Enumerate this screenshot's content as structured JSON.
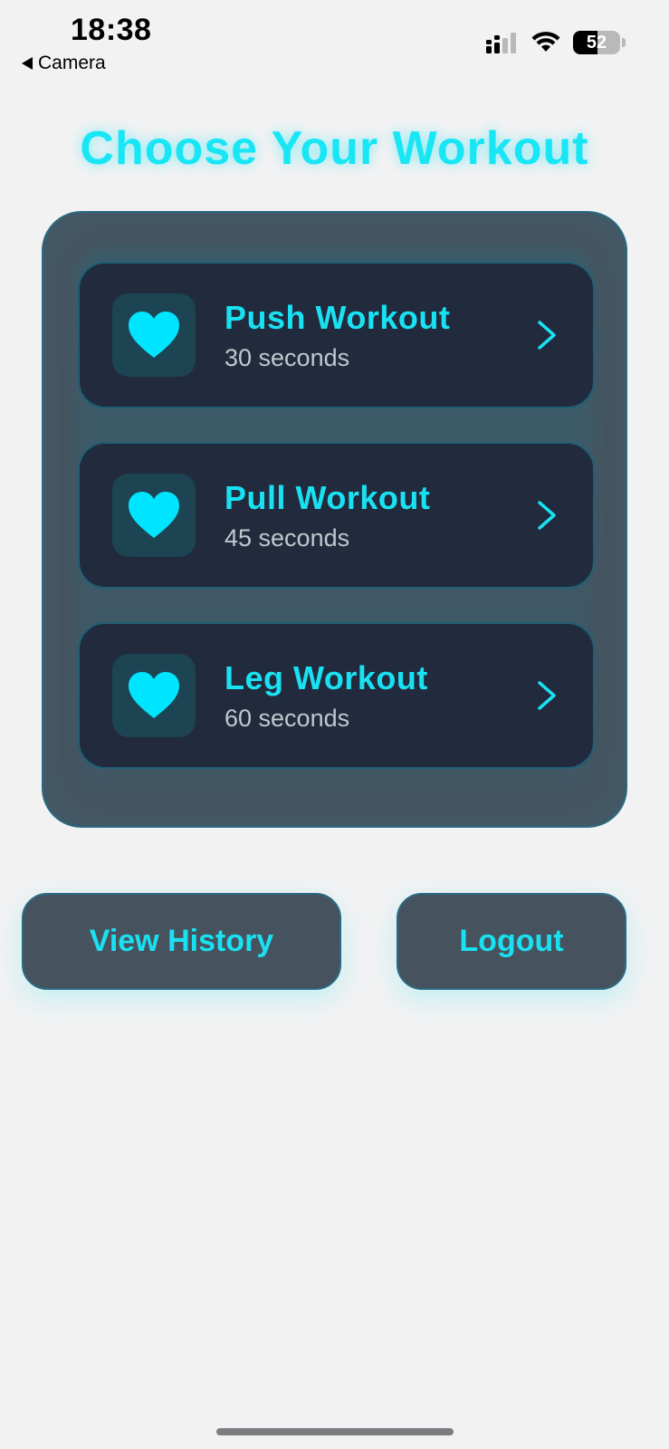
{
  "status_bar": {
    "time": "18:38",
    "back_label": "Camera",
    "battery_level": "52",
    "icons": [
      "cellular-signal-icon",
      "wifi-icon",
      "battery-icon"
    ]
  },
  "page": {
    "title": "Choose Your Workout"
  },
  "workouts": [
    {
      "title": "Push Workout",
      "duration": "30 seconds",
      "icon": "heart-icon"
    },
    {
      "title": "Pull Workout",
      "duration": "45 seconds",
      "icon": "heart-icon"
    },
    {
      "title": "Leg Workout",
      "duration": "60 seconds",
      "icon": "heart-icon"
    }
  ],
  "actions": {
    "history_label": "View History",
    "logout_label": "Logout"
  },
  "colors": {
    "accent": "#19e6f5",
    "card_bg": "#212b3d",
    "panel_bg": "#46535f",
    "background": "#f2f2f3"
  }
}
